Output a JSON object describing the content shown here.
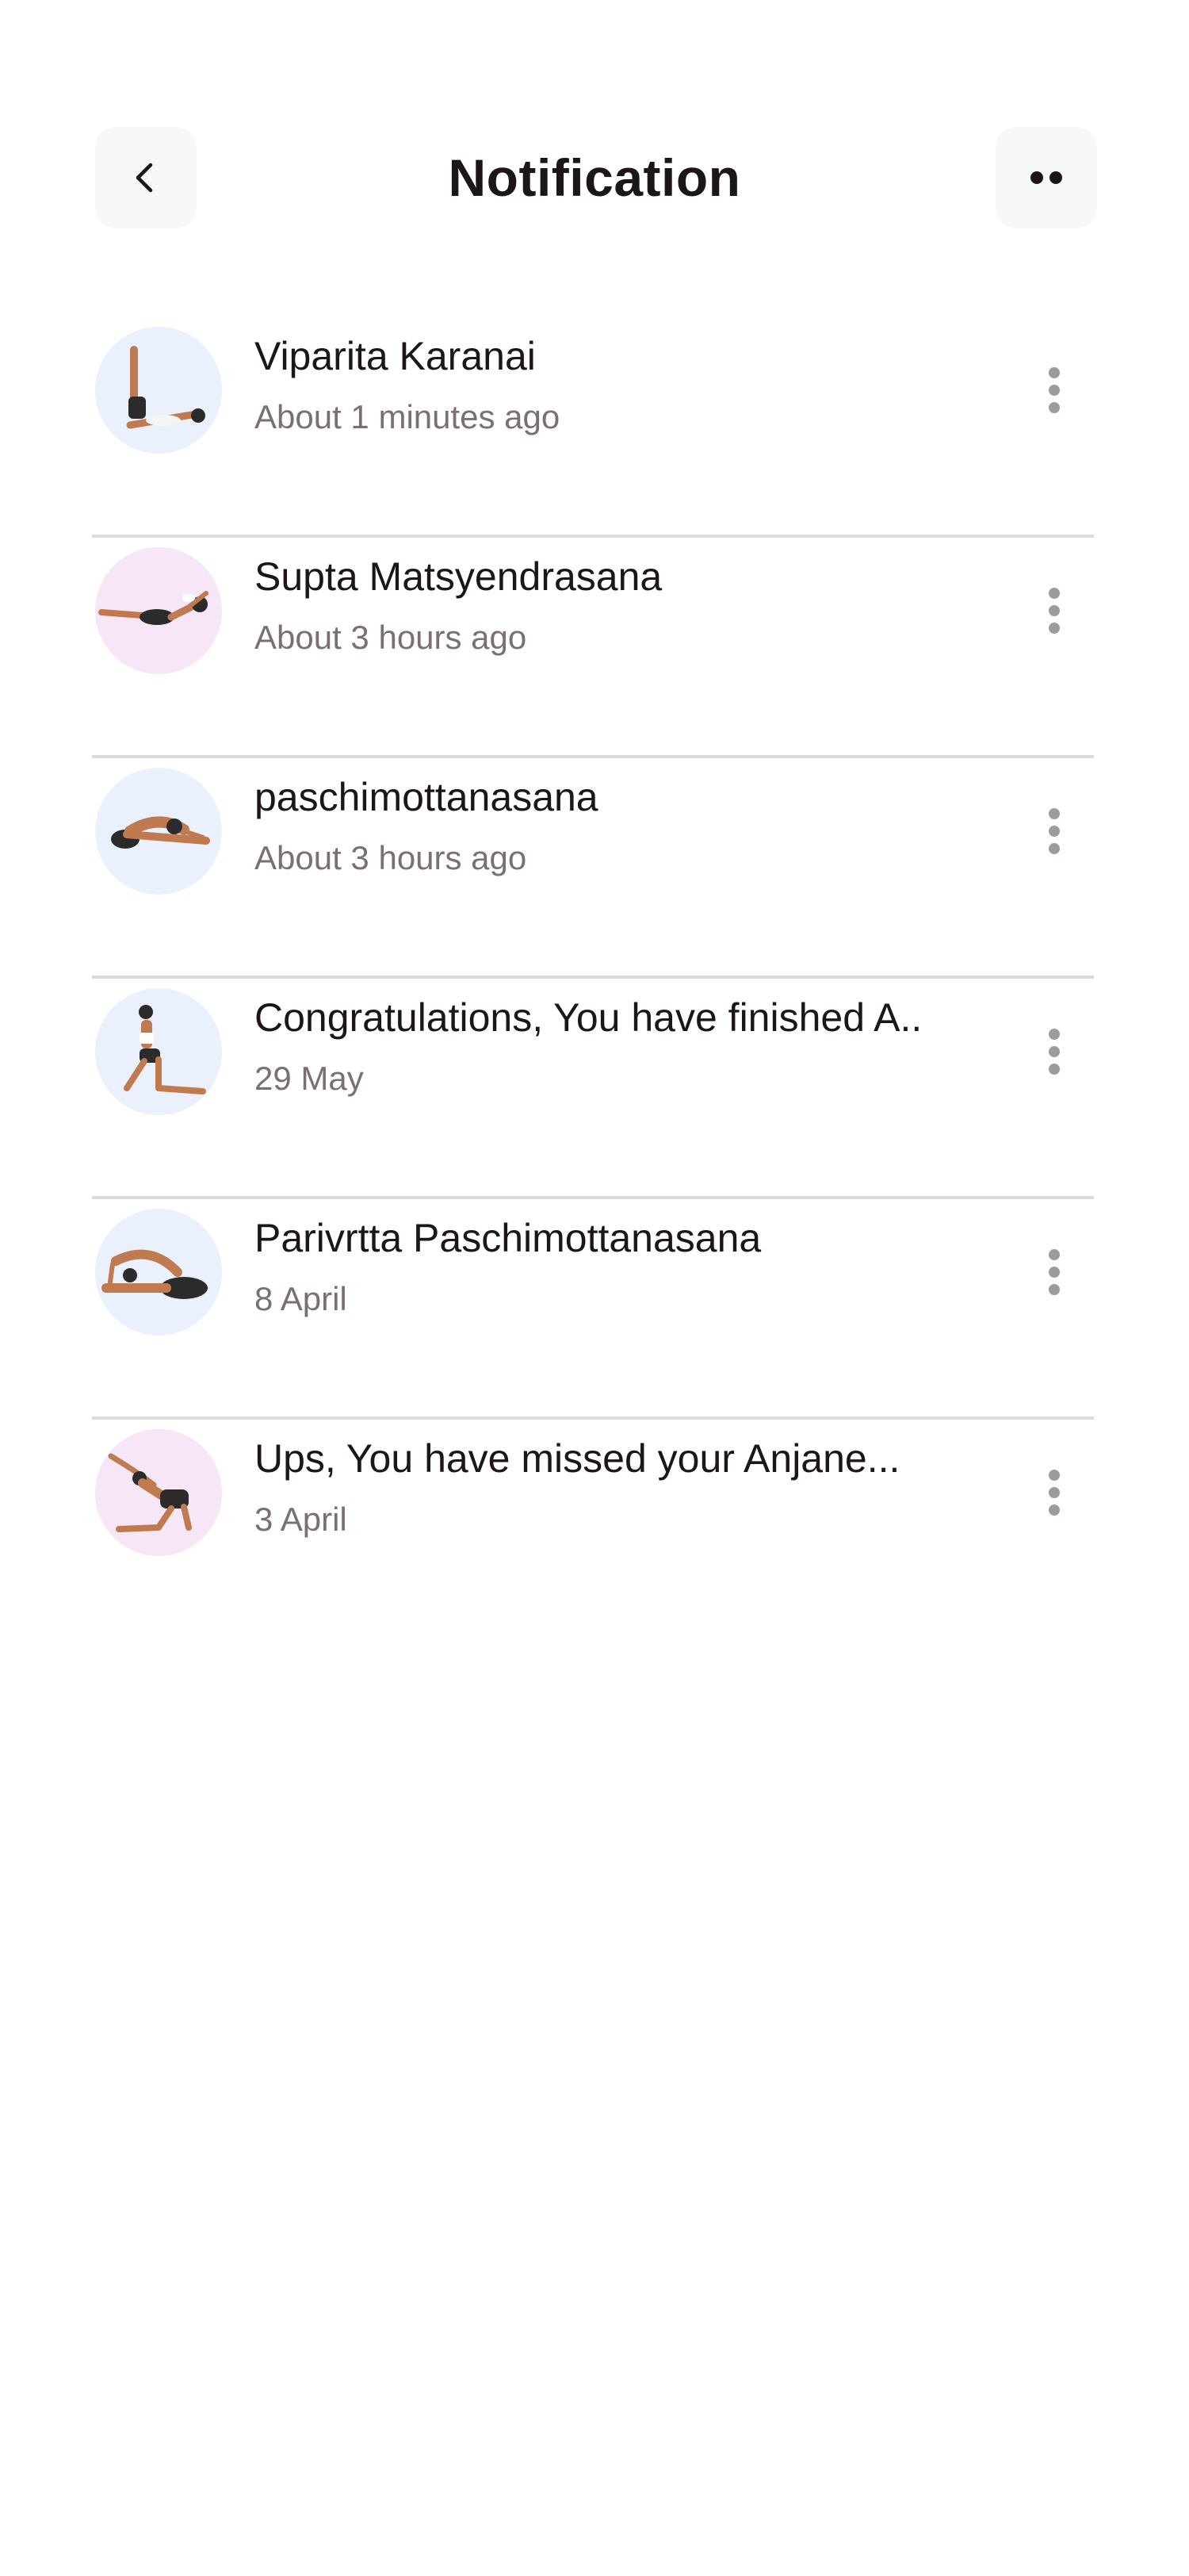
{
  "header": {
    "title": "Notification",
    "back_icon": "chevron-left-icon",
    "more_icon": "more-dots-icon"
  },
  "notifications": [
    {
      "title": "Viparita Karanai",
      "time": "About 1 minutes ago",
      "avatar_bg": "#eaf1fd"
    },
    {
      "title": "Supta Matsyendrasana",
      "time": "About 3 hours ago",
      "avatar_bg": "#f7e7f6"
    },
    {
      "title": "paschimottanasana",
      "time": "About 3 hours ago",
      "avatar_bg": "#eaf1fd"
    },
    {
      "title": "Congratulations, You have finished A..",
      "time": "29 May",
      "avatar_bg": "#eaf1fd"
    },
    {
      "title": "Parivrtta Paschimottanasana",
      "time": "8 April",
      "avatar_bg": "#eaf1fd"
    },
    {
      "title": "Ups, You have missed your Anjane...",
      "time": "3 April",
      "avatar_bg": "#f7e7f6"
    }
  ],
  "colors": {
    "title": "#1d1617",
    "subtitle": "#7b6f72",
    "divider": "#dddada",
    "button_bg": "#f7f8f8",
    "skin": "#c07a4f",
    "clothing": "#2b2b2b"
  }
}
